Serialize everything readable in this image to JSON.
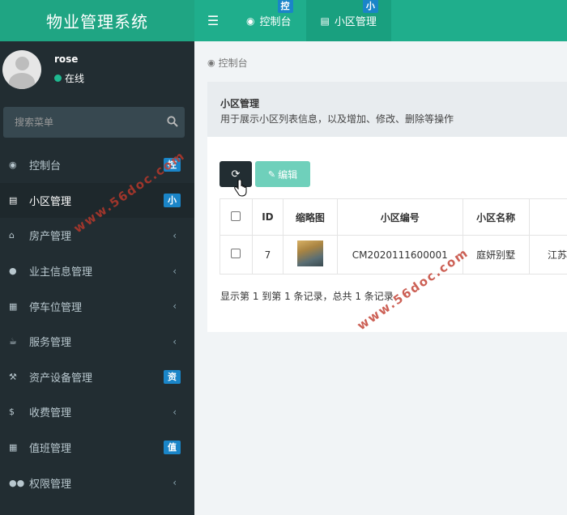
{
  "app": {
    "title": "物业管理系统"
  },
  "topbar": {
    "tabs": [
      {
        "label": "控制台",
        "badge": "控"
      },
      {
        "label": "小区管理",
        "badge": "小"
      }
    ]
  },
  "user": {
    "name": "rose",
    "status": "在线"
  },
  "search": {
    "placeholder": "搜索菜单"
  },
  "sidebar": {
    "items": [
      {
        "label": "控制台",
        "icon": "dashboard-icon",
        "badge": "控"
      },
      {
        "label": "小区管理",
        "icon": "list-icon",
        "badge": "小"
      },
      {
        "label": "房产管理",
        "icon": "home-icon"
      },
      {
        "label": "业主信息管理",
        "icon": "user-icon"
      },
      {
        "label": "停车位管理",
        "icon": "film-icon"
      },
      {
        "label": "服务管理",
        "icon": "coffee-icon"
      },
      {
        "label": "资产设备管理",
        "icon": "gavel-icon",
        "badge": "资"
      },
      {
        "label": "收费管理",
        "icon": "dollar-icon"
      },
      {
        "label": "值班管理",
        "icon": "calendar-icon",
        "badge": "值"
      },
      {
        "label": "权限管理",
        "icon": "group-icon"
      }
    ]
  },
  "breadcrumb": {
    "label": "控制台"
  },
  "panel": {
    "title": "小区管理",
    "description": "用于展示小区列表信息，以及增加、修改、删除等操作"
  },
  "toolbar": {
    "edit_label": "编辑"
  },
  "table": {
    "headers": [
      "ID",
      "缩略图",
      "小区编号",
      "小区名称",
      ""
    ],
    "rows": [
      {
        "id": "7",
        "code": "CM2020111600001",
        "name": "庭妍别墅",
        "extra": "江苏"
      }
    ]
  },
  "pagination": {
    "info": "显示第 1 到第 1 条记录，总共 1 条记录"
  },
  "watermark": {
    "text": "www.56doc.com"
  },
  "colors": {
    "brand": "#1fa583",
    "sidebar": "#222d32",
    "badge": "#1a85c8",
    "edit_button": "#6fd0bb"
  }
}
